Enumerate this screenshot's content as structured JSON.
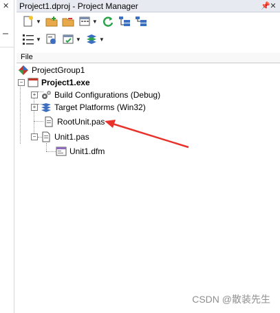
{
  "window": {
    "title": "Project1.dproj - Project Manager",
    "pin_glyph": "📌",
    "close_glyph": "✕"
  },
  "left_strip": {
    "close_glyph": "✕"
  },
  "file_header": "File",
  "tree": {
    "group": "ProjectGroup1",
    "project": "Project1.exe",
    "build_configurations": "Build Configurations (Debug)",
    "target_platforms": "Target Platforms (Win32)",
    "root_unit": "RootUnit.pas",
    "unit1": "Unit1.pas",
    "unit1_form": "Unit1.dfm",
    "expand_glyph": "+",
    "collapse_glyph": "−"
  },
  "annotation": {
    "arrow_color": "#e8322b"
  },
  "watermark": "CSDN @散装先生"
}
